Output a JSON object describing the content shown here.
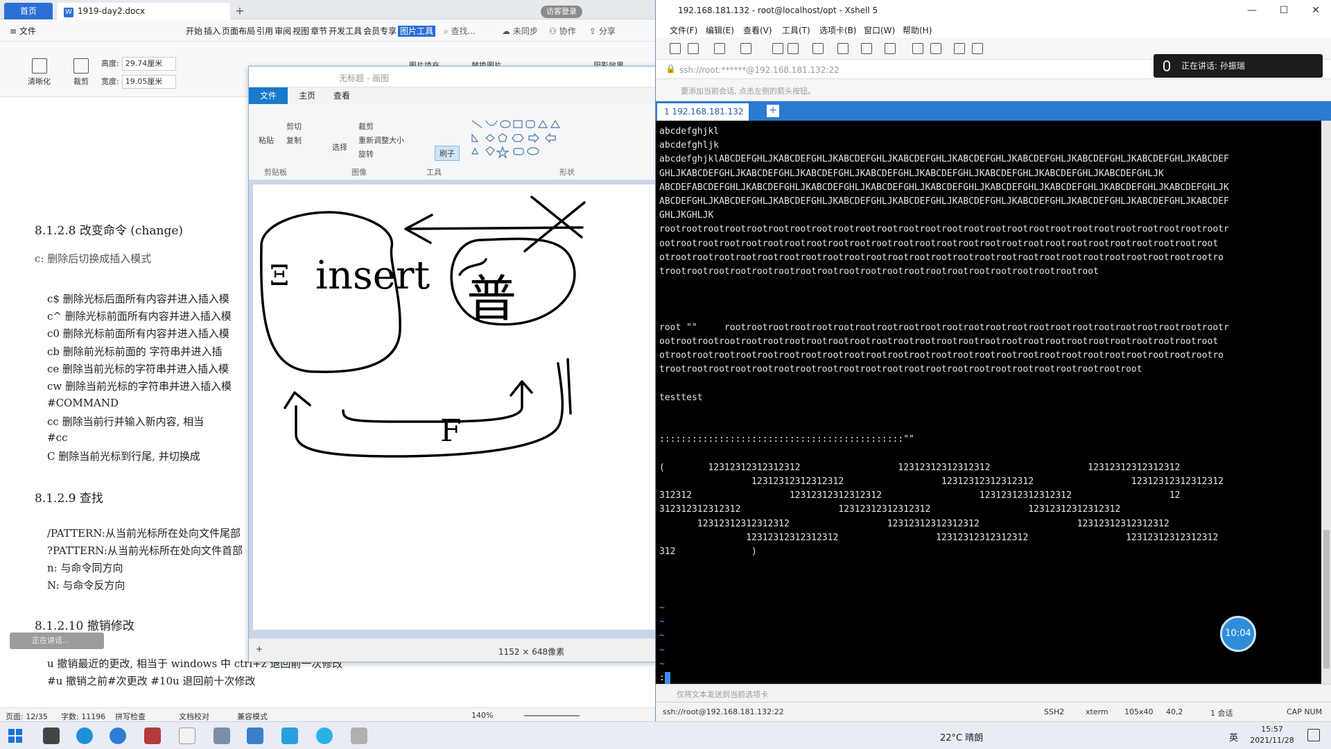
{
  "wps": {
    "tabs": {
      "home": "首页",
      "doc": "1919-day2.docx"
    },
    "login_badge": "访客登录",
    "menu": {
      "file": "文件",
      "tabs": [
        "开始",
        "插入",
        "页面布局",
        "引用",
        "审阅",
        "视图",
        "章节",
        "开发工具",
        "会员专享"
      ],
      "active_tab": "图片工具",
      "search": "查找...",
      "sync": "未同步",
      "collab": "协作",
      "share": "分享"
    },
    "toolbar": {
      "clarify": "清晰化",
      "crop": "裁剪",
      "height_label": "高度:",
      "height_value": "29.74厘米",
      "width_label": "宽度:",
      "width_value": "19.05厘米",
      "picture_fill": "图片填充",
      "replace_picture": "替换图片",
      "shadow_effect": "阴影效果"
    },
    "doc_lines": [
      {
        "text": "8.1.2.8 改变命令 (change)",
        "type": "heading"
      },
      {
        "text": "c: 删除后切换成插入模式",
        "type": "gray"
      },
      {
        "text": "c$  删除光标后面所有内容并进入插入模",
        "type": "normal"
      },
      {
        "text": "c^  删除光标前面所有内容并进入插入模",
        "type": "normal"
      },
      {
        "text": "c0  删除光标前面所有内容并进入插入模",
        "type": "normal"
      },
      {
        "text": "cb  删除前光标前面的 字符串并进入插",
        "type": "normal"
      },
      {
        "text": "ce  删除当前光标的字符串并进入插入模",
        "type": "normal"
      },
      {
        "text": "cw  删除当前光标的字符串并进入插入模",
        "type": "normal"
      },
      {
        "text": "#COMMAND",
        "type": "normal"
      },
      {
        "text": "cc      删除当前行并输入新内容, 相当",
        "type": "normal"
      },
      {
        "text": "#cc",
        "type": "normal"
      },
      {
        "text": "C       删除当前光标到行尾, 并切换成",
        "type": "normal"
      },
      {
        "text": "8.1.2.9 查找",
        "type": "heading"
      },
      {
        "text": "/PATTERN:从当前光标所在处向文件尾部",
        "type": "normal"
      },
      {
        "text": "?PATTERN:从当前光标所在处向文件首部",
        "type": "normal"
      },
      {
        "text": "n: 与命令同方向",
        "type": "normal"
      },
      {
        "text": "N: 与命令反方向",
        "type": "normal"
      },
      {
        "text": "8.1.2.10 撤销修改",
        "type": "heading"
      },
      {
        "text": "u       撤销最近的更改, 相当于 windows 中 ctrl+z  退回前一次修改",
        "type": "normal"
      },
      {
        "text": "#u      撤销之前#次更改   #10u 退回前十次修改",
        "type": "normal"
      }
    ],
    "status": {
      "page": "页面: 12/35",
      "words": "字数: 11196",
      "spell": "拼写检查",
      "proof": "文档校对",
      "compat": "兼容模式",
      "zoom": "140%"
    },
    "floating_bar": "正在讲话..."
  },
  "paint": {
    "title": "无标题 - 画图",
    "tabs": {
      "file": "文件",
      "home": "主页",
      "view": "查看"
    },
    "ribbon": {
      "paste": "粘贴",
      "cut": "剪切",
      "copy": "复制",
      "select": "选择",
      "crop": "裁剪",
      "resize": "重新调整大小",
      "rotate": "旋转",
      "brush": "刷子",
      "groups": [
        "剪贴板",
        "图像",
        "工具",
        "形状"
      ]
    },
    "drawing_labels": {
      "insert": "insert",
      "left_mark": "Ξ",
      "normal": "普",
      "bottom": "F"
    },
    "canvas_size": "1152 × 648像素"
  },
  "xshell": {
    "title": "192.168.181.132 - root@localhost/opt - Xshell 5",
    "menu": [
      "文件(F)",
      "编辑(E)",
      "查看(V)",
      "工具(T)",
      "选项卡(B)",
      "窗口(W)",
      "帮助(H)"
    ],
    "address": "ssh://root:******@192.168.181.132:22",
    "hint": "要添加当前会话, 点击左侧的箭头按钮。",
    "tab_label": "1 192.168.181.132",
    "terminal_lines": [
      "abcdefghjkl",
      "abcdefghljk",
      "abcdefghjklABCDEFGHLJKABCDEFGHLJKABCDEFGHLJKABCDEFGHLJKABCDEFGHLJKABCDEFGHLJKABCDEFGHLJKABCDEFGHLJKABCDEF",
      "GHLJKABCDEFGHLJKABCDEFGHLJKABCDEFGHLJKABCDEFGHLJKABCDEFGHLJKABCDEFGHLJKABCDEFGHLJKABCDEFGHLJK",
      "ABCDEFABCDEFGHLJKABCDEFGHLJKABCDEFGHLJKABCDEFGHLJKABCDEFGHLJKABCDEFGHLJKABCDEFGHLJKABCDEFGHLJKABCDEFGHLJK",
      "ABCDEFGHLJKABCDEFGHLJKABCDEFGHLJKABCDEFGHLJKABCDEFGHLJKABCDEFGHLJKABCDEFGHLJKABCDEFGHLJKABCDEFGHLJKABCDEF",
      "GHLJKGHLJK",
      "rootrootrootrootrootrootrootrootrootrootrootrootrootrootrootrootrootrootrootrootrootrootrootrootrootrootr",
      "ootrootrootrootrootrootrootrootrootrootrootrootrootrootrootrootrootrootrootrootrootrootrootrootrootroot",
      "otrootrootrootrootrootrootrootrootrootrootrootrootrootrootrootrootrootrootrootrootrootrootrootrootrootro",
      "trootrootrootrootrootrootrootrootrootrootrootrootrootrootrootrootrootrootrootroot",
      "",
      "",
      "",
      "root \"\"     rootrootrootrootrootrootrootrootrootrootrootrootrootrootrootrootrootrootrootrootrootrootrootr",
      "ootrootrootrootrootrootrootrootrootrootrootrootrootrootrootrootrootrootrootrootrootrootrootrootrootroot",
      "otrootrootrootrootrootrootrootrootrootrootrootrootrootrootrootrootrootrootrootrootrootrootrootrootrootro",
      "trootrootrootrootrootrootrootrootrootrootrootrootrootrootrootrootrootrootrootrootrootroot",
      "",
      "testtest",
      "",
      "",
      ":::::::::::::::::::::::::::::::::::::::::::::\"\"",
      "",
      "(        12312312312312312                  12312312312312312                  12312312312312312",
      "                 12312312312312312                  12312312312312312                  12312312312312312",
      "312312                  12312312312312312                  12312312312312312                  12",
      "312312312312312                  12312312312312312                  12312312312312312",
      "       12312312312312312                  12312312312312312                  12312312312312312",
      "                12312312312312312                  12312312312312312                  12312312312312312",
      "312              )",
      "",
      "",
      "",
      "~",
      "~",
      "~",
      "~",
      "~",
      ":"
    ],
    "compose_hint": "仅将文本发送到当前选项卡",
    "status": {
      "conn": "ssh://root@192.168.181.132:22",
      "proto": "SSH2",
      "term": "xterm",
      "size": "105x40",
      "pos": "40,2",
      "sessions": "1 会话",
      "caps": "CAP NUM"
    },
    "timer": "10:04",
    "speaking": "正在讲话: 孙振瑞"
  },
  "taskbar": {
    "weather": "22°C 晴朗",
    "ime": "英",
    "time": "15:57",
    "date": "2021/11/28"
  }
}
